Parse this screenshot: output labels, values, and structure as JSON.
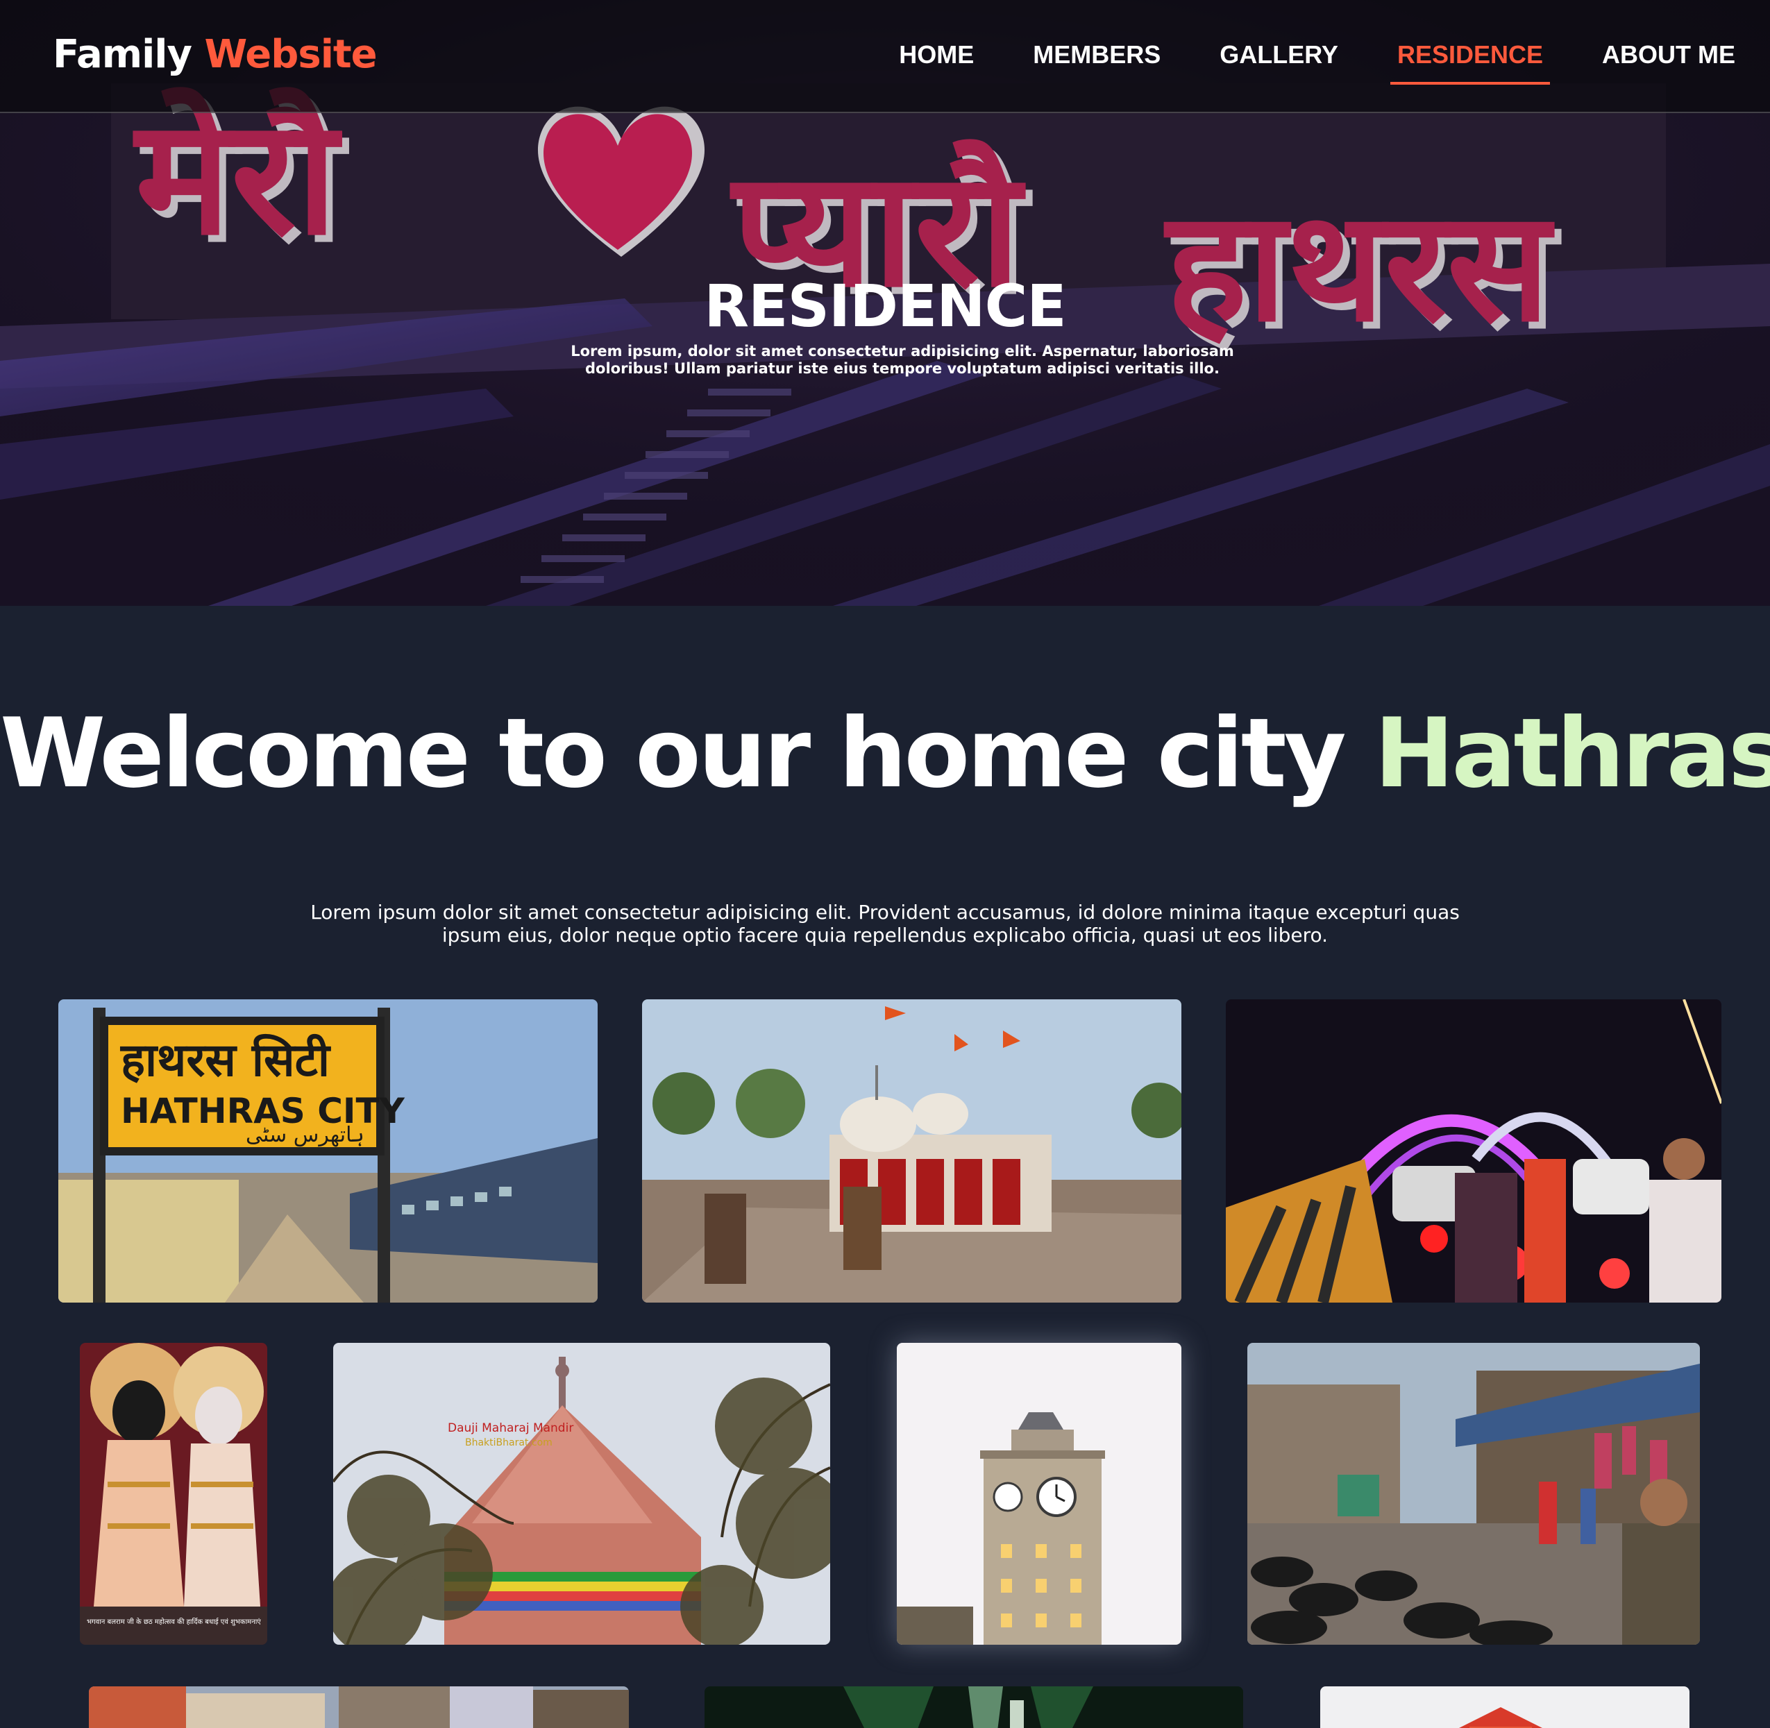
{
  "brand": {
    "first": "Family",
    "second": "Website"
  },
  "nav": {
    "items": [
      {
        "label": "HOME",
        "active": false
      },
      {
        "label": "MEMBERS",
        "active": false
      },
      {
        "label": "GALLERY",
        "active": false
      },
      {
        "label": "RESIDENCE",
        "active": true
      },
      {
        "label": "ABOUT ME",
        "active": false
      }
    ]
  },
  "hero": {
    "title": "RESIDENCE",
    "subtitle": "Lorem ipsum, dolor sit amet consectetur adipisicing elit. Aspernatur, laboriosam doloribus! Ullam pariatur iste eius tempore voluptatum adipisci veritatis illo.",
    "sign_text": "मेरौ ♥ प्यारौ हाथरस"
  },
  "welcome": {
    "prefix": "Welcome to our home city ",
    "highlight": "Hathras",
    "paragraph": "Lorem ipsum dolor sit amet consectetur adipisicing elit. Provident accusamus, id dolore minima itaque excepturi quas ipsum eius, dolor neque optio facere quia repellendus explicabo officia, quasi ut eos libero."
  },
  "photos": {
    "station_sign_hindi": "हाथरस सिटी",
    "station_sign_english": "HATHRAS CITY",
    "station_sign_urdu": "ہاتھرس سٹی",
    "dauji_caption_1": "Dauji Maharaj Mandir",
    "dauji_caption_2": "BhaktiBharat.com",
    "idol_caption": "भगवान बलराम जी के छठ महोत्सव की हार्दिक बधाई एवं शुभकामनाएं"
  },
  "colors": {
    "accent": "#ff5a3c",
    "highlight": "#d6f5c2",
    "background": "#1b2130"
  }
}
